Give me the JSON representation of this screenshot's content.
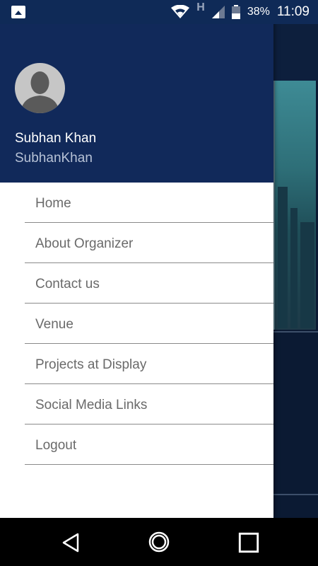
{
  "status_bar": {
    "network_label": "H",
    "battery_percent": "38%",
    "time": "11:09",
    "icons": [
      "image-icon",
      "wifi-icon",
      "signal-icon",
      "battery-icon"
    ]
  },
  "drawer": {
    "user": {
      "name": "Subhan Khan",
      "username": "SubhanKhan"
    },
    "menu": [
      {
        "label": "Home"
      },
      {
        "label": "About Organizer"
      },
      {
        "label": "Contact us"
      },
      {
        "label": "Venue"
      },
      {
        "label": "Projects at Display"
      },
      {
        "label": "Social Media Links"
      },
      {
        "label": "Logout"
      }
    ]
  },
  "nav_bar": {
    "icons": [
      "back-icon",
      "home-icon",
      "recent-apps-icon"
    ]
  },
  "colors": {
    "header_bg": "#11295a",
    "status_bar_bg": "#0f2a57",
    "menu_text": "#6a6a6a",
    "divider": "#8a8a8a"
  }
}
